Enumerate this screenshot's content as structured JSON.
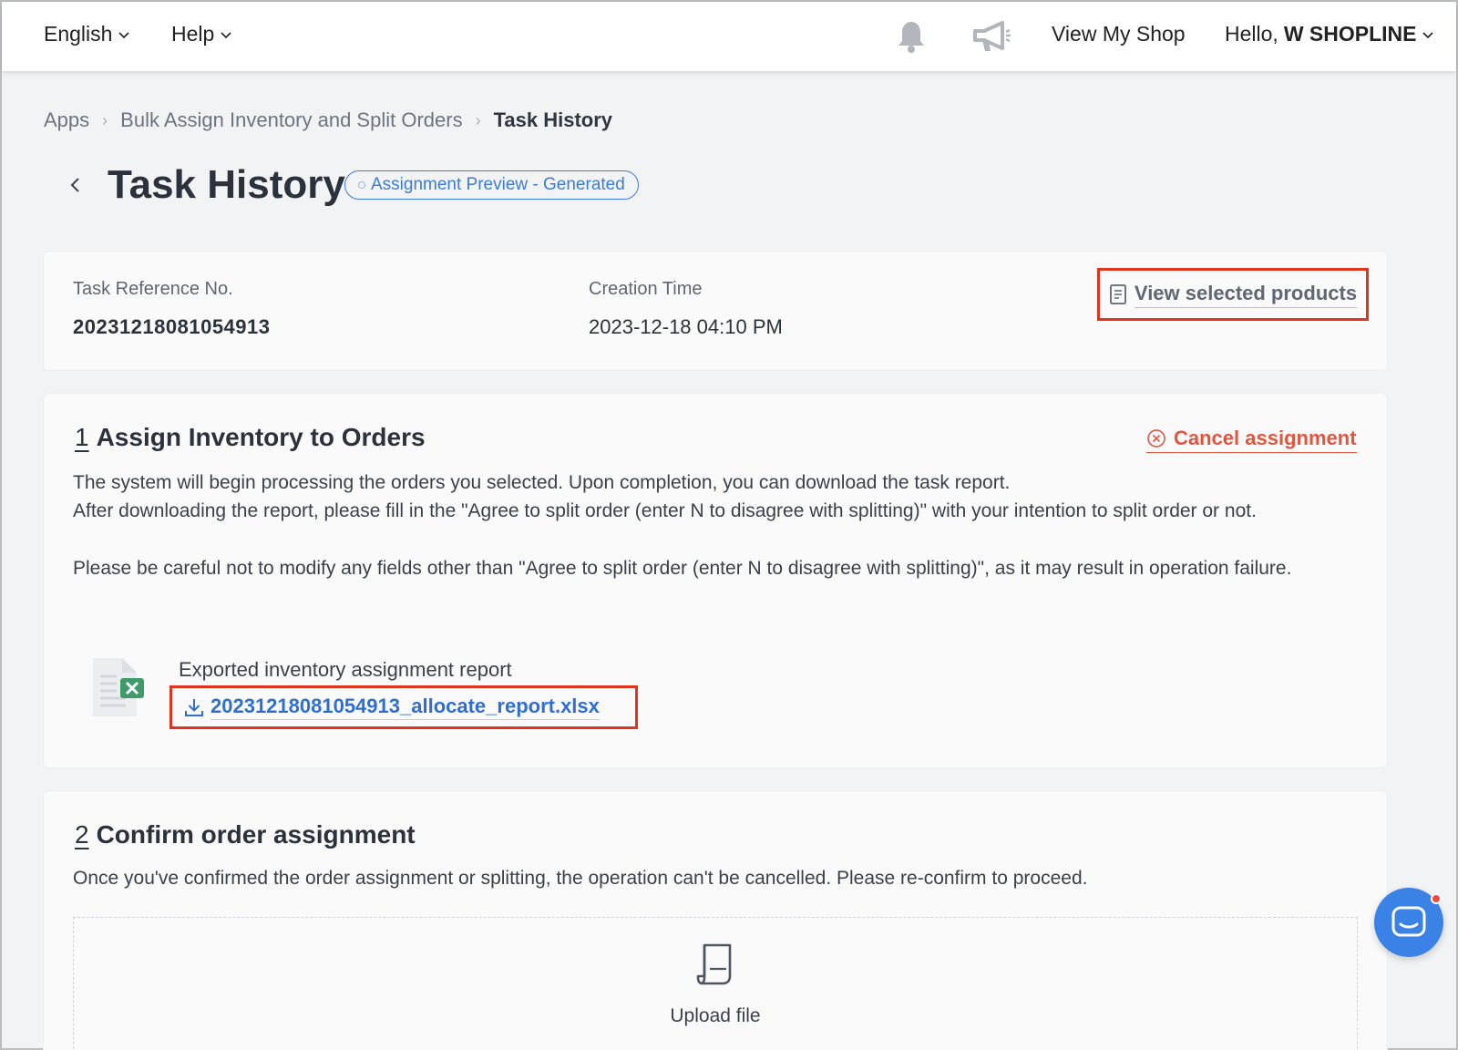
{
  "topbar": {
    "language_label": "English",
    "help_label": "Help",
    "view_shop_label": "View My Shop",
    "greeting": "Hello,",
    "user_name": "W SHOPLINE"
  },
  "breadcrumb": {
    "items": [
      "Apps",
      "Bulk Assign Inventory and Split Orders",
      "Task History"
    ]
  },
  "page": {
    "title": "Task History",
    "status_badge": "Assignment Preview - Generated"
  },
  "task_info": {
    "reference_label": "Task Reference No.",
    "reference_value": "20231218081054913",
    "creation_label": "Creation Time",
    "creation_value": "2023-12-18 04:10 PM",
    "view_products_label": "View selected products"
  },
  "step1": {
    "number": "1",
    "title": "Assign Inventory to Orders",
    "cancel_label": "Cancel assignment",
    "paragraphs": [
      "The system will begin processing the orders you selected. Upon completion, you can download the task report.",
      "After downloading the report, please fill in the \"Agree to split order (enter N to disagree with splitting)\" with your intention to split order or not.",
      "Please be careful not to modify any fields other than \"Agree to split order (enter N to disagree with splitting)\", as it may result in operation failure."
    ],
    "report_label": "Exported inventory assignment report",
    "report_file": "20231218081054913_allocate_report.xlsx"
  },
  "step2": {
    "number": "2",
    "title": "Confirm order assignment",
    "description": "Once you've confirmed the order assignment or splitting, the operation can't be cancelled. Please re-confirm to proceed.",
    "upload_label": "Upload file"
  },
  "colors": {
    "accent_blue": "#2f6fd0",
    "danger": "#e2553f",
    "highlight_border": "#e0341d",
    "chat_button": "#3b82e6"
  },
  "icons": [
    "chevron-down-icon",
    "bell-icon",
    "megaphone-icon",
    "back-arrow-icon",
    "document-list-icon",
    "cancel-circle-icon",
    "excel-file-icon",
    "download-icon",
    "upload-file-icon",
    "chat-icon"
  ]
}
